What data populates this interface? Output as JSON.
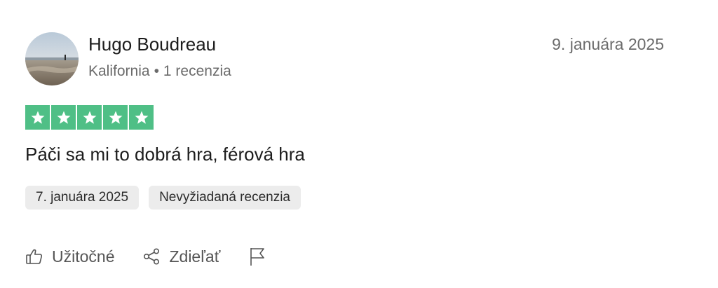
{
  "author": {
    "name": "Hugo Boudreau",
    "location": "Kalifornia",
    "separator": "•",
    "review_count": "1 recenzia"
  },
  "review": {
    "date": "9. januára 2025",
    "rating": 5,
    "rating_max": 5,
    "text": "Páči sa mi to dobrá hra, férová hra",
    "experience_date": "7. januára 2025",
    "tag": "Nevyžiadaná recenzia"
  },
  "actions": {
    "useful_label": "Užitočné",
    "share_label": "Zdieľať"
  },
  "icons": {
    "useful": "thumbs-up-icon",
    "share": "share-icon",
    "report": "flag-icon",
    "star": "star-icon"
  },
  "colors": {
    "star_fill": "#4fbf86",
    "tag_bg": "#ececec",
    "muted_text": "#6b6b6b"
  }
}
